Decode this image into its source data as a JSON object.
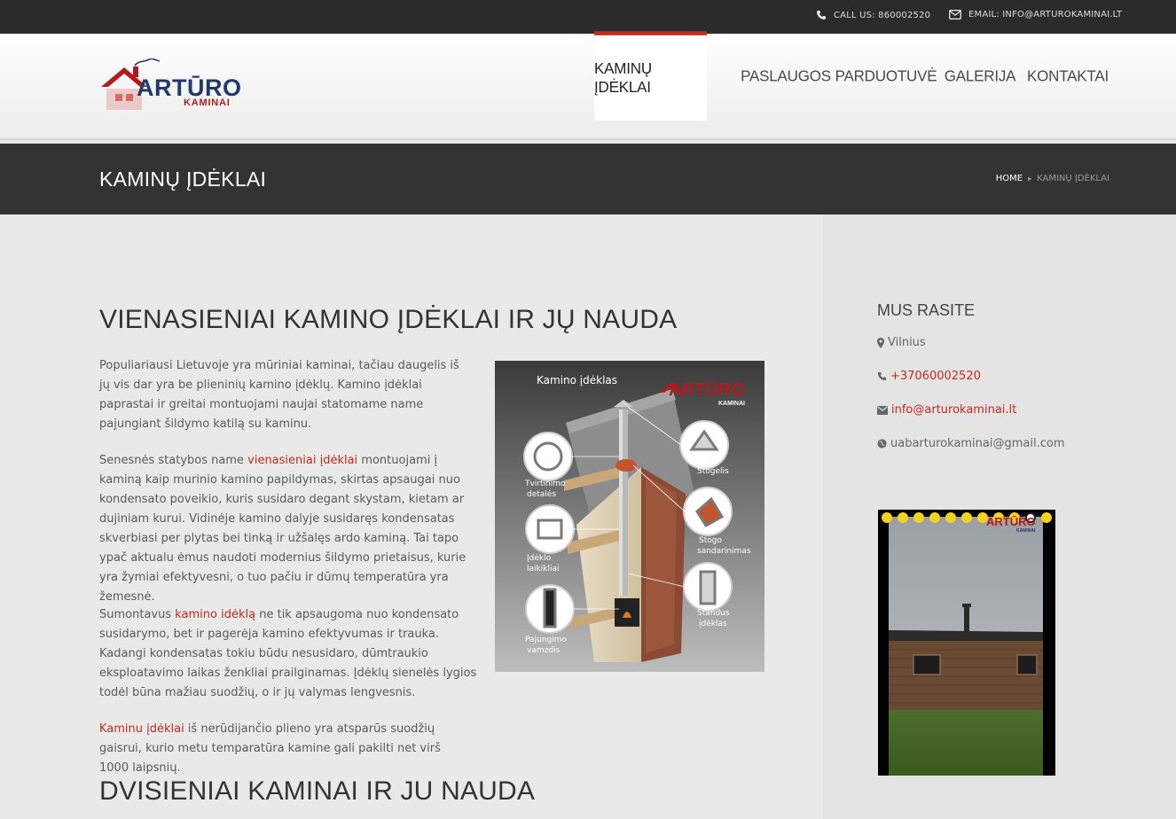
{
  "topbar": {
    "phone_icon": "phone-icon",
    "phone": "CALL US: 860002520",
    "mail_icon": "envelope-icon",
    "email": "EMAIL: INFO@ARTUROKAMINAI.LT"
  },
  "logo": {
    "title": "ARTŪRO",
    "subtitle": "KAMINAI"
  },
  "nav": {
    "items": [
      {
        "label": "KAMINŲ ĮDĖKLAI",
        "active": true
      },
      {
        "label": "PASLAUGOS"
      },
      {
        "label": "PARDUOTUVĖ"
      },
      {
        "label": "GALERIJA"
      },
      {
        "label": "KONTAKTAI"
      }
    ]
  },
  "titlebar": {
    "title": "KAMINŲ ĮDĖKLAI",
    "breadcrumb_home": "HOME",
    "breadcrumb_sep": "▸",
    "breadcrumb_current": "KAMINŲ ĮDĖKLAI"
  },
  "content": {
    "heading1": "VIENASIENIAI KAMINO ĮDĖKLAI IR JŲ NAUDA",
    "p1": "Populiariausi Lietuvoje yra mūriniai kaminai, tačiau daugelis iš jų vis dar yra be plieninių kamino įdėklų. Kamino įdėklai paprastai ir greitai montuojami naujai statomame name pajungiant šildymo katilą su kaminu.",
    "p2_before": "Senesnės statybos name ",
    "p2_link": "vienasieniai įdėklai",
    "p2_after": " montuojami į kaminą kaip murinio kamino papildymas, skirtas apsaugai nuo kondensato poveikio, kuris susidaro degant skystam, kietam ar dujiniam kurui. Vidinėje kamino dalyje susidaręs kondensatas skverbiasi per plytas bei tinką ir užšalęs ardo kaminą. Tai tapo ypač aktualu ėmus naudoti modernius šildymo prietaisus, kurie yra žymiai efektyvesni, o tuo pačiu ir dūmų temperatūra yra žemesnė.",
    "p3_before": "Sumontavus ",
    "p3_link": "kamino idėklą",
    "p3_after": " ne tik apsaugoma nuo kondensato susidarymo, bet ir pagerėja kamino efektyvumas ir trauka. Kadangi kondensatas tokiu būdu nesusidaro, dūmtraukio eksploatavimo laikas ženkliai prailginamas. Įdėklų sienelės lygios todėl būna mažiau suodžių, o ir jų valymas lengvesnis.",
    "p4_link": "Kaminu įdėklai",
    "p4_after": " iš nerūdijančio plieno yra atsparūs suodžių gaisrui, kurio metu temparatūra kamine gali pakilti net virš 1000 laipsnių.",
    "heading2": "DVISIENIAI KAMINAI IR JU NAUDA"
  },
  "diagram": {
    "title": "Kamino įdėklas",
    "logo": "ARTŪRO",
    "logo_sub": "KAMINAI",
    "label_tvirtinimo": "Tvirtinimo",
    "label_detales": "detalės",
    "label_idklo": "Įdėklo",
    "label_laikikliai": "laikikliai",
    "label_pajungimo": "Pajungimo",
    "label_vamzdis": "vamzdis",
    "label_stogelis": "Stogelis",
    "label_stogo": "Stogo",
    "label_sandarinimas": "sandarinimas",
    "label_standus": "Standus",
    "label_idklas": "įdėklas"
  },
  "sidebar": {
    "title": "MUS RASITE",
    "city": "Vilnius",
    "phone": "+37060002520",
    "email": "info@arturokaminai.lt",
    "gmail": "uabarturokaminai@gmail.com",
    "slider_logo": "ARTŪRO",
    "slider_logo_sub": "KAMINAI",
    "slider_dots": 11,
    "slider_active_dot": 9
  },
  "colors": {
    "accent": "#c8281e",
    "dark": "#333333",
    "topbar": "#2b2b2b",
    "dot": "#f5d21e"
  }
}
